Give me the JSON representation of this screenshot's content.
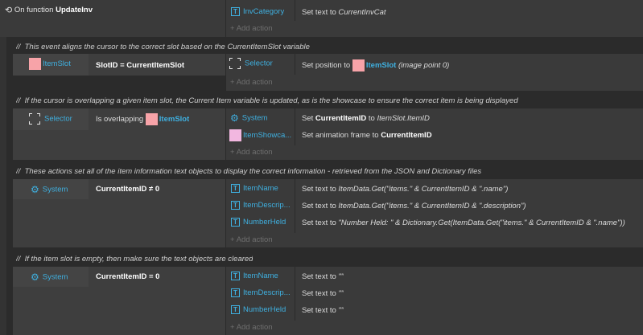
{
  "function_block": {
    "icon": "refresh-icon",
    "title_prefix": "On function ",
    "title_name": "UpdateInv",
    "action": {
      "object": "InvCategory",
      "icon": "text-icon",
      "text_prefix": "Set text to ",
      "text_value": "CurrentInvCat"
    },
    "add_action": "Add action"
  },
  "events": [
    {
      "comment": "This event aligns the cursor to the correct slot based on the CurrentItemSlot variable",
      "condition_object": "ItemSlot",
      "condition_text": "SlotID = CurrentItemSlot",
      "actions": [
        {
          "object": "Selector",
          "icon": "selector-icon",
          "text": "Set position to ",
          "target": "ItemSlot",
          "suffix": " (image point 0)"
        }
      ],
      "add_action": "Add action"
    },
    {
      "comment": "If the cursor is overlapping a given item slot, the Current Item variable is updated, as is the showcase to ensure the correct item is being displayed",
      "condition_object": "Selector",
      "condition_text": "Is overlapping ",
      "condition_target": "ItemSlot",
      "actions": [
        {
          "object": "System",
          "text_prefix": "Set ",
          "bold": "CurrentItemID",
          "text_mid": " to ",
          "italic": "ItemSlot.ItemID"
        },
        {
          "object": "ItemShowca...",
          "text_prefix": "Set animation frame to ",
          "bold": "CurrentItemID"
        }
      ],
      "add_action": "Add action"
    },
    {
      "comment": "These actions set all of the item information text objects to display the correct information - retrieved from the JSON and Dictionary files",
      "condition_object": "System",
      "condition_text": "CurrentItemID ≠ 0",
      "actions": [
        {
          "object": "ItemName",
          "text_prefix": "Set text to ",
          "italic": "ItemData.Get(\"items.\" & CurrentItemID & \".name\")"
        },
        {
          "object": "ItemDescrip...",
          "text_prefix": "Set text to ",
          "italic": "ItemData.Get(\"items.\" & CurrentItemID & \".description\")"
        },
        {
          "object": "NumberHeld",
          "text_prefix": "Set text to ",
          "italic": "\"Number Held: \" & Dictionary.Get(ItemData.Get(\"items.\" & CurrentItemID & \".name\"))"
        }
      ],
      "add_action": "Add action"
    },
    {
      "comment": "If the item slot is empty, then make sure the text objects are cleared",
      "condition_object": "System",
      "condition_text": "CurrentItemID = 0",
      "actions": [
        {
          "object": "ItemName",
          "text_prefix": "Set text to ",
          "italic": "\"\""
        },
        {
          "object": "ItemDescrip...",
          "text_prefix": "Set text to ",
          "italic": "\"\""
        },
        {
          "object": "NumberHeld",
          "text_prefix": "Set text to ",
          "italic": "\"\""
        }
      ],
      "add_action": "Add action"
    }
  ],
  "comment_prefix": "//"
}
